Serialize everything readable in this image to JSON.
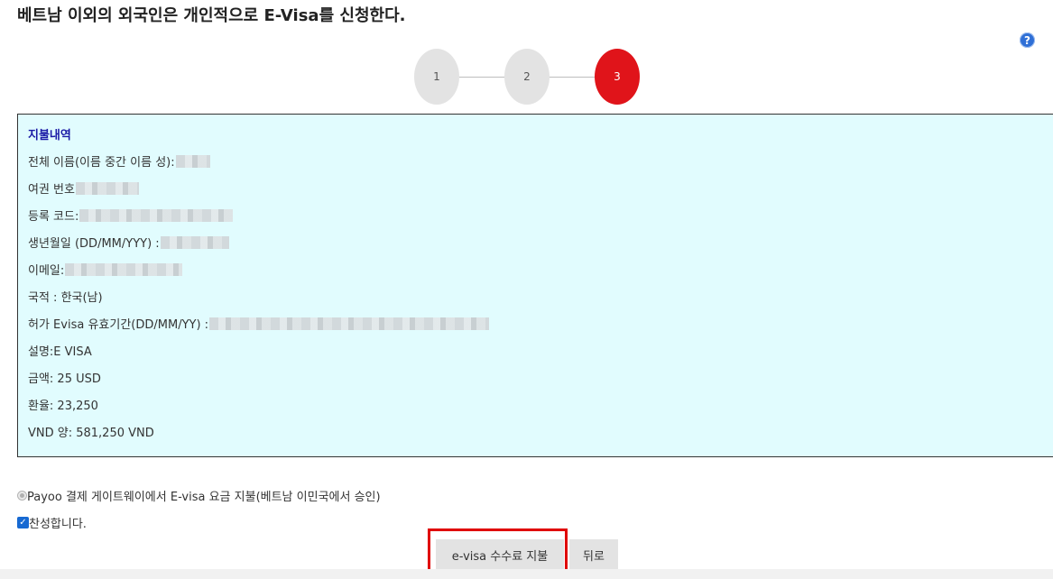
{
  "page": {
    "title": "베트남 이외의 외국인은 개인적으로 E-Visa를 신청한다.",
    "help_icon": "?"
  },
  "steps": [
    {
      "label": "1",
      "active": false
    },
    {
      "label": "2",
      "active": false
    },
    {
      "label": "3",
      "active": true
    }
  ],
  "payment": {
    "heading": "지불내역",
    "rows": [
      {
        "label": "전체 이름(이름 중간 이름 성):",
        "redacted": true
      },
      {
        "label": "여권 번호",
        "redacted": true
      },
      {
        "label": "등록 코드:",
        "redacted": true
      },
      {
        "label": "생년월일 (DD/MM/YYY) : ",
        "redacted": true
      },
      {
        "label": "이메일:",
        "redacted": true
      },
      {
        "label": "국적 : 한국(남)",
        "redacted": false
      },
      {
        "label": "허가 Evisa 유효기간(DD/MM/YY) : ",
        "redacted": true
      },
      {
        "label": "설명:E VISA",
        "redacted": false
      },
      {
        "label": "금액: 25 USD",
        "redacted": false
      },
      {
        "label": "환율: 23,250",
        "redacted": false
      },
      {
        "label": "VND 양: 581,250 VND",
        "redacted": false
      }
    ]
  },
  "options": {
    "gateway_label": "Payoo 결제 게이트웨이에서 E-visa 요금 지불(베트남 이민국에서 승인)",
    "agree_label": "찬성합니다.",
    "agree_checked": true
  },
  "buttons": {
    "pay": "e-visa 수수료 지불",
    "back": "뒤로"
  },
  "colors": {
    "panel_bg": "#e1fcfe",
    "active_step": "#e0141a",
    "heading": "#1a1aa6",
    "highlight": "#e00000"
  }
}
